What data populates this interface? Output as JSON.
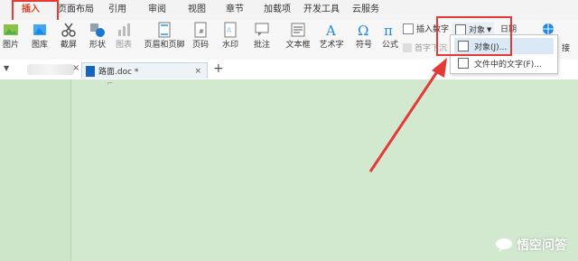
{
  "menu": {
    "tabs": [
      {
        "label": "插入",
        "active": true
      },
      {
        "label": "页面布局"
      },
      {
        "label": "引用"
      },
      {
        "label": "审阅"
      },
      {
        "label": "视图"
      },
      {
        "label": "章节"
      },
      {
        "label": "加载项"
      },
      {
        "label": "开发工具"
      },
      {
        "label": "云服务"
      }
    ]
  },
  "ribbon": {
    "picture": "图片",
    "gallery": "图库",
    "screenshot": "截屏",
    "shapes": "形状",
    "chart": "图表",
    "header_footer": "页眉和页脚",
    "page_number": "页码",
    "watermark": "水印",
    "comment": "批注",
    "textbox": "文本框",
    "wordart": "艺术字",
    "symbol": "符号",
    "formula": "公式",
    "insert_number": "插入数字",
    "drop_cap": "首字下沉",
    "object": "对象",
    "date": "日期",
    "partial": "接"
  },
  "object_menu": {
    "items": [
      {
        "label": "对象(J)..."
      },
      {
        "label": "文件中的文字(F)..."
      }
    ]
  },
  "tabs": {
    "document": "路面.doc *",
    "add": "+",
    "close": "×"
  },
  "watermark": {
    "text": "悟空问答"
  },
  "colors": {
    "accent": "#d24726",
    "annotation": "#e53935",
    "background": "#d2e9cf"
  }
}
